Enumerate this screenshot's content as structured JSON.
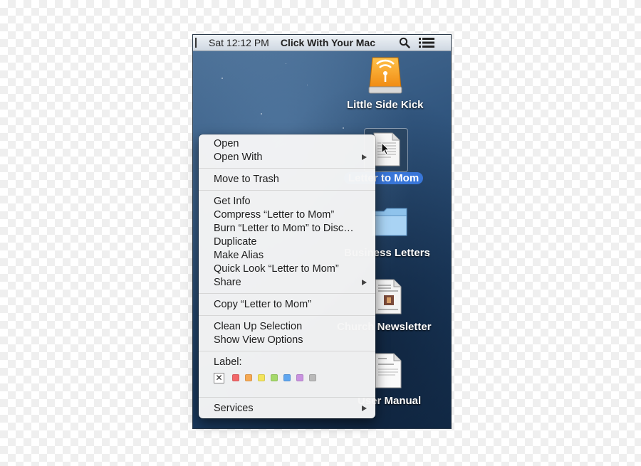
{
  "menubar": {
    "clock": "Sat 12:12 PM",
    "app_title": "Click With Your Mac",
    "search_icon": "magnifier-icon",
    "list_icon": "notification-list-icon"
  },
  "desktop": {
    "items": [
      {
        "label": "Little Side Kick",
        "icon": "external-drive-icon"
      },
      {
        "label": "Letter to Mom",
        "icon": "document-icon",
        "selected": true
      },
      {
        "label": "Business Letters",
        "icon": "folder-icon"
      },
      {
        "label": "Church Newsletter",
        "icon": "document-icon"
      },
      {
        "label": "User Manual",
        "icon": "document-icon"
      }
    ]
  },
  "context_menu": {
    "open": "Open",
    "open_with": "Open With",
    "move_to_trash": "Move to Trash",
    "get_info": "Get Info",
    "compress": "Compress “Letter to Mom”",
    "burn": "Burn “Letter to Mom” to Disc…",
    "duplicate": "Duplicate",
    "make_alias": "Make Alias",
    "quick_look": "Quick Look “Letter to Mom”",
    "share": "Share",
    "copy": "Copy “Letter to Mom”",
    "clean_up": "Clean Up Selection",
    "show_view_options": "Show View Options",
    "label_title": "Label:",
    "label_colors": [
      "#f2686a",
      "#f6a954",
      "#f3e45c",
      "#a5d96a",
      "#5fa6f0",
      "#c992e0",
      "#b9b9b9"
    ],
    "services": "Services"
  }
}
